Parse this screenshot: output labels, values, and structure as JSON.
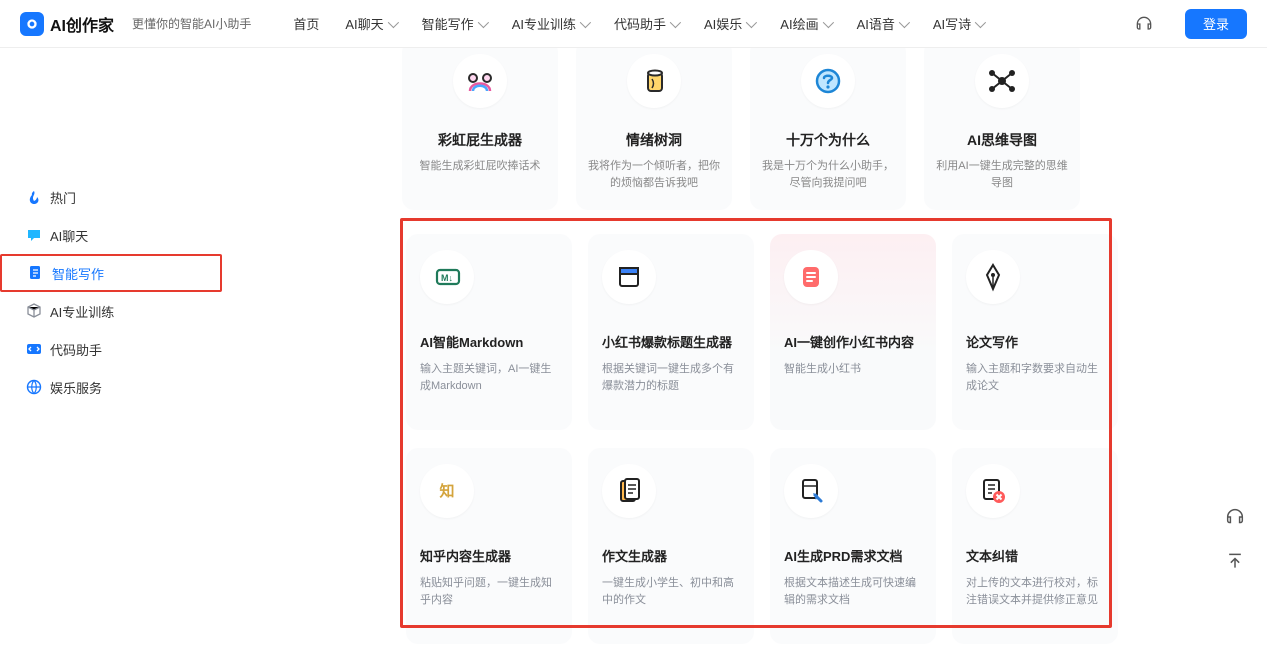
{
  "header": {
    "brand": "AI创作家",
    "tagline": "更懂你的智能AI小助手",
    "nav": [
      {
        "label": "首页",
        "dropdown": false
      },
      {
        "label": "AI聊天",
        "dropdown": true
      },
      {
        "label": "智能写作",
        "dropdown": true
      },
      {
        "label": "AI专业训练",
        "dropdown": true
      },
      {
        "label": "代码助手",
        "dropdown": true
      },
      {
        "label": "AI娱乐",
        "dropdown": true
      },
      {
        "label": "AI绘画",
        "dropdown": true
      },
      {
        "label": "AI语音",
        "dropdown": true
      },
      {
        "label": "AI写诗",
        "dropdown": true
      }
    ],
    "login": "登录"
  },
  "sidebar": {
    "items": [
      {
        "label": "热门",
        "icon": "flame",
        "color": "#1677ff"
      },
      {
        "label": "AI聊天",
        "icon": "chat",
        "color": "#1890ff"
      },
      {
        "label": "智能写作",
        "icon": "doc",
        "color": "#1677ff",
        "active": true
      },
      {
        "label": "AI专业训练",
        "icon": "cube",
        "color": "#8a8f99"
      },
      {
        "label": "代码助手",
        "icon": "code",
        "color": "#1677ff"
      },
      {
        "label": "娱乐服务",
        "icon": "globe",
        "color": "#1677ff"
      }
    ]
  },
  "row1": [
    {
      "title": "彩虹屁生成器",
      "desc": "智能生成彩虹屁吹捧话术",
      "icon": "rainbow"
    },
    {
      "title": "情绪树洞",
      "desc": "我将作为一个倾听者，把你的烦恼都告诉我吧",
      "icon": "cup"
    },
    {
      "title": "十万个为什么",
      "desc": "我是十万个为什么小助手，尽管向我提问吧",
      "icon": "question"
    },
    {
      "title": "AI思维导图",
      "desc": "利用AI一键生成完整的思维导图",
      "icon": "mindmap"
    }
  ],
  "grid": [
    {
      "title": "AI智能Markdown",
      "desc": "输入主题关键词，AI一键生成Markdown",
      "icon": "md",
      "alt": false
    },
    {
      "title": "小红书爆款标题生成器",
      "desc": "根据关键词一键生成多个有爆款潜力的标题",
      "icon": "window",
      "alt": false
    },
    {
      "title": "AI一键创作小红书内容",
      "desc": "智能生成小红书",
      "icon": "note",
      "alt": true
    },
    {
      "title": "论文写作",
      "desc": "输入主题和字数要求自动生成论文",
      "icon": "pen",
      "alt": false
    },
    {
      "title": "知乎内容生成器",
      "desc": "粘贴知乎问题，一键生成知乎内容",
      "icon": "zhi",
      "alt": false
    },
    {
      "title": "作文生成器",
      "desc": "一键生成小学生、初中和高中的作文",
      "icon": "essay",
      "alt": false
    },
    {
      "title": "AI生成PRD需求文档",
      "desc": "根据文本描述生成可快速编辑的需求文档",
      "icon": "prd",
      "alt": false
    },
    {
      "title": "文本纠错",
      "desc": "对上传的文本进行校对，标注错误文本并提供修正意见",
      "icon": "correct",
      "alt": false
    }
  ]
}
